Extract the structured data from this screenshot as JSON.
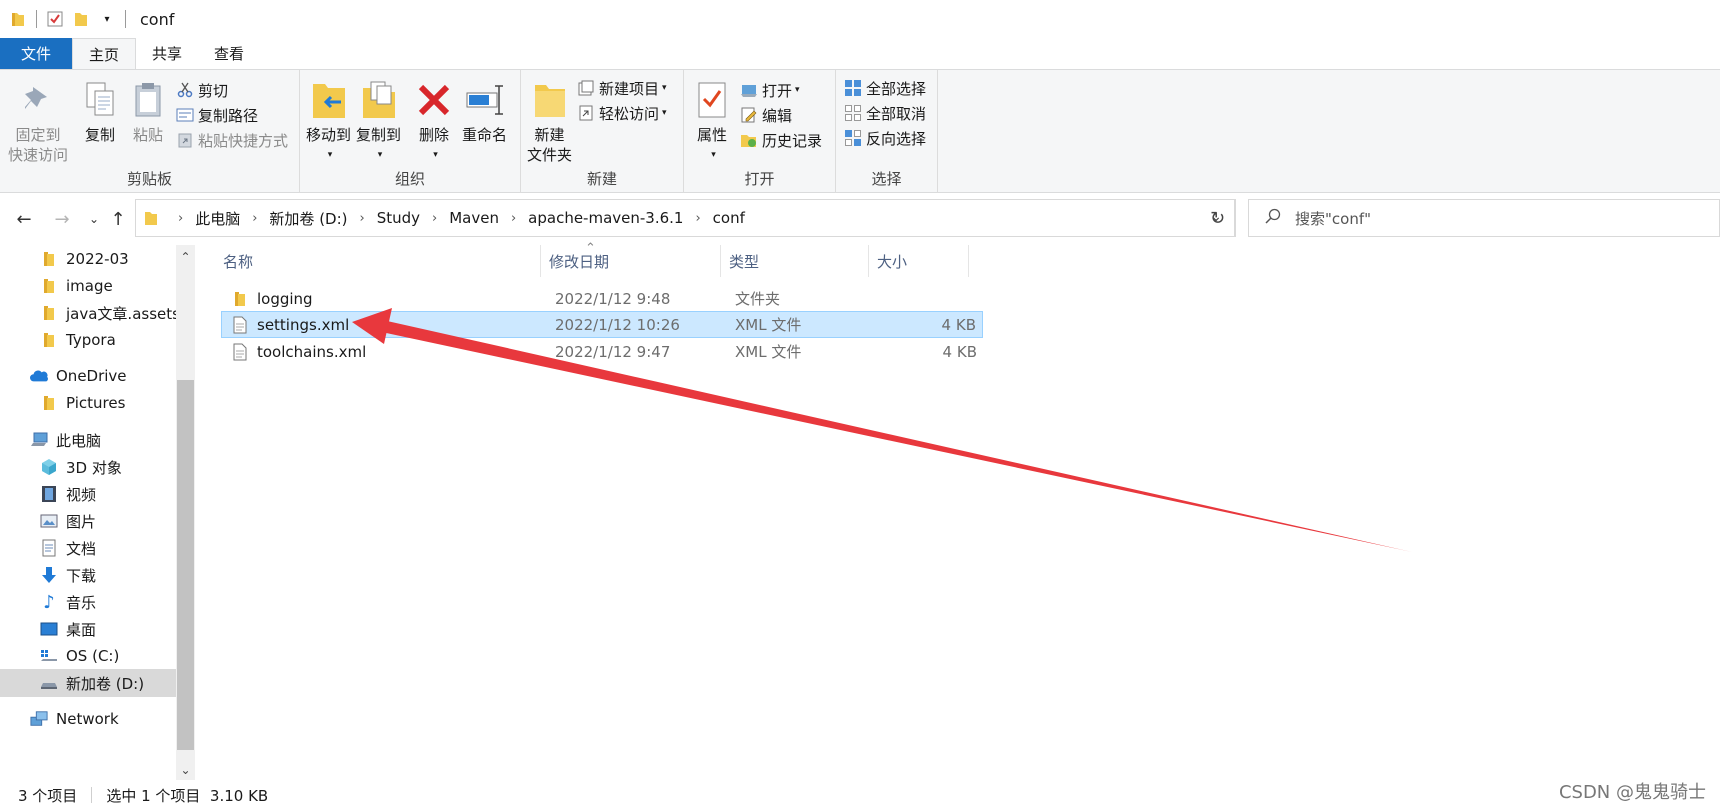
{
  "window": {
    "title": "conf"
  },
  "ribbon_tabs": [
    "文件",
    "主页",
    "共享",
    "查看"
  ],
  "ribbon": {
    "clipboard": {
      "label": "剪贴板",
      "pin_line1": "固定到",
      "pin_line2": "快速访问",
      "copy": "复制",
      "paste": "粘贴",
      "cut": "剪切",
      "copy_path": "复制路径",
      "paste_shortcut": "粘贴快捷方式"
    },
    "organize": {
      "label": "组织",
      "move_to": "移动到",
      "copy_to": "复制到",
      "delete": "删除",
      "rename": "重命名"
    },
    "new": {
      "label": "新建",
      "new_folder_line1": "新建",
      "new_folder_line2": "文件夹",
      "new_item": "新建项目",
      "easy_access": "轻松访问"
    },
    "open": {
      "label": "打开",
      "properties": "属性",
      "open": "打开",
      "edit": "编辑",
      "history": "历史记录"
    },
    "select": {
      "label": "选择",
      "select_all": "全部选择",
      "select_none": "全部取消",
      "invert": "反向选择"
    }
  },
  "address": {
    "crumbs": [
      "此电脑",
      "新加卷 (D:)",
      "Study",
      "Maven",
      "apache-maven-3.6.1",
      "conf"
    ],
    "search_placeholder": "搜索\"conf\""
  },
  "nav_pane": [
    "2022-03",
    "image",
    "java文章.assets",
    "Typora",
    "OneDrive",
    "Pictures",
    "此电脑",
    "3D 对象",
    "视频",
    "图片",
    "文档",
    "下载",
    "音乐",
    "桌面",
    "OS (C:)",
    "新加卷 (D:)",
    "Network"
  ],
  "columns": {
    "name": "名称",
    "date": "修改日期",
    "type": "类型",
    "size": "大小"
  },
  "files": [
    {
      "name": "logging",
      "date": "2022/1/12 9:48",
      "type": "文件夹",
      "size": ""
    },
    {
      "name": "settings.xml",
      "date": "2022/1/12 10:26",
      "type": "XML 文件",
      "size": "4 KB"
    },
    {
      "name": "toolchains.xml",
      "date": "2022/1/12 9:47",
      "type": "XML 文件",
      "size": "4 KB"
    }
  ],
  "status": {
    "count": "3 个项目",
    "selection": "选中 1 个项目  3.10 KB"
  },
  "watermark": "CSDN @鬼鬼骑士",
  "colors": {
    "file_tab": "#1a6fc1",
    "selection": "#cce8ff",
    "folder": "#f2c94c",
    "arrow": "#e8383d"
  }
}
